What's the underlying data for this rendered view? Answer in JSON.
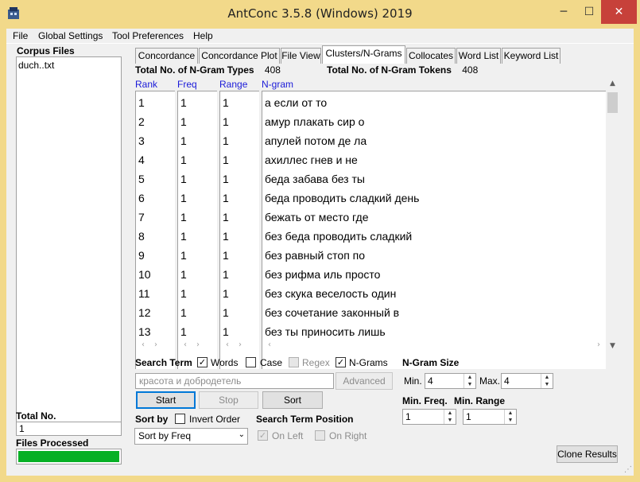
{
  "window": {
    "title": "AntConc 3.5.8 (Windows) 2019",
    "min_label": "─",
    "max_label": "☐",
    "close_label": "✕"
  },
  "menu": [
    "File",
    "Global Settings",
    "Tool Preferences",
    "Help"
  ],
  "sidebar": {
    "corpus_files_label": "Corpus Files",
    "files": [
      "duch..txt"
    ],
    "total_no_label": "Total No.",
    "total_no_value": "1",
    "files_processed_label": "Files Processed",
    "progress": 1.0
  },
  "tabs": [
    "Concordance",
    "Concordance Plot",
    "File View",
    "Clusters/N-Grams",
    "Collocates",
    "Word List",
    "Keyword List"
  ],
  "active_tab": "Clusters/N-Grams",
  "stats": {
    "types_label": "Total No. of N-Gram Types",
    "types_value": "408",
    "tokens_label": "Total No. of N-Gram Tokens",
    "tokens_value": "408"
  },
  "columns": {
    "rank": "Rank",
    "freq": "Freq",
    "range": "Range",
    "ngram": "N-gram"
  },
  "rows": [
    {
      "rank": "1",
      "freq": "1",
      "range": "1",
      "ngram": "а если от то"
    },
    {
      "rank": "2",
      "freq": "1",
      "range": "1",
      "ngram": "амур плакать сир о"
    },
    {
      "rank": "3",
      "freq": "1",
      "range": "1",
      "ngram": "апулей потом де ла"
    },
    {
      "rank": "4",
      "freq": "1",
      "range": "1",
      "ngram": "ахиллес гнев и не"
    },
    {
      "rank": "5",
      "freq": "1",
      "range": "1",
      "ngram": "беда забава без ты"
    },
    {
      "rank": "6",
      "freq": "1",
      "range": "1",
      "ngram": "беда проводить сладкий день"
    },
    {
      "rank": "7",
      "freq": "1",
      "range": "1",
      "ngram": "бежать от место где"
    },
    {
      "rank": "8",
      "freq": "1",
      "range": "1",
      "ngram": "без беда проводить сладкий"
    },
    {
      "rank": "9",
      "freq": "1",
      "range": "1",
      "ngram": "без равный стоп по"
    },
    {
      "rank": "10",
      "freq": "1",
      "range": "1",
      "ngram": "без рифма иль просто"
    },
    {
      "rank": "11",
      "freq": "1",
      "range": "1",
      "ngram": "без скука веселость один"
    },
    {
      "rank": "12",
      "freq": "1",
      "range": "1",
      "ngram": "без сочетание законный в"
    },
    {
      "rank": "13",
      "freq": "1",
      "range": "1",
      "ngram": "без ты приносить лишь"
    }
  ],
  "search": {
    "search_term_label": "Search Term",
    "words_label": "Words",
    "words_checked": true,
    "case_label": "Case",
    "case_checked": false,
    "regex_label": "Regex",
    "regex_checked": false,
    "ngrams_label": "N-Grams",
    "ngrams_checked": true,
    "term_placeholder": "красота и добродетель",
    "advanced_label": "Advanced",
    "start_label": "Start",
    "stop_label": "Stop",
    "sort_label": "Sort"
  },
  "ngram_size": {
    "label": "N-Gram Size",
    "min_label": "Min.",
    "min_value": "4",
    "max_label": "Max.",
    "max_value": "4"
  },
  "filters": {
    "min_freq_label": "Min. Freq.",
    "min_freq_value": "1",
    "min_range_label": "Min. Range",
    "min_range_value": "1"
  },
  "sort": {
    "sort_by_label": "Sort by",
    "invert_order_label": "Invert Order",
    "invert_checked": false,
    "sort_by_value": "Sort by Freq",
    "position_label": "Search Term Position",
    "on_left_label": "On Left",
    "on_left_checked": true,
    "on_right_label": "On Right",
    "on_right_checked": false
  },
  "clone_results_label": "Clone Results",
  "check_mark": "✓",
  "colors": {
    "title_bar": "#f2d98a",
    "close": "#c7413a",
    "progress": "#06b025",
    "column_header": "#1a1ad8"
  }
}
